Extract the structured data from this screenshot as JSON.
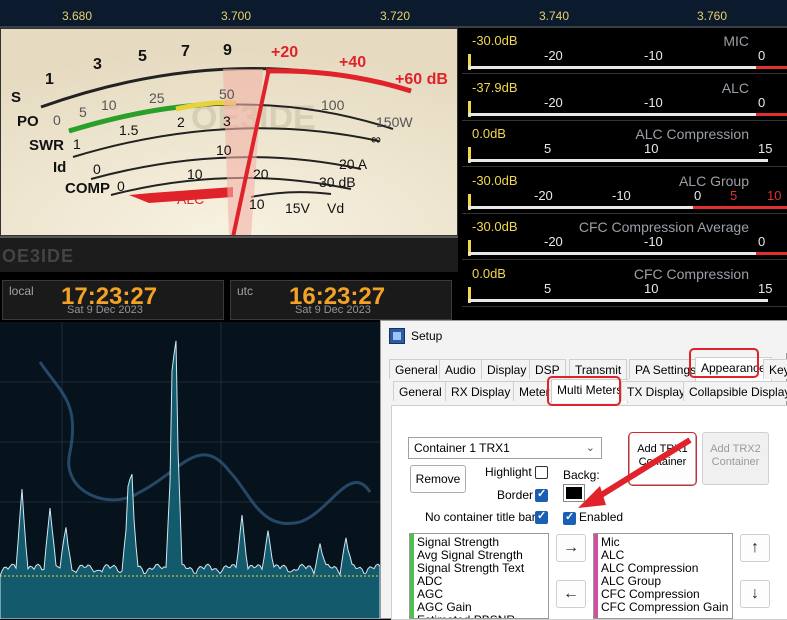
{
  "freq": {
    "labels": [
      "3.680",
      "3.700",
      "3.720",
      "3.740",
      "3.760"
    ]
  },
  "meter": {
    "s_label": "S",
    "po_label": "PO",
    "swr_label": "SWR",
    "id_label": "Id",
    "comp_label": "COMP",
    "s_scale": [
      "1",
      "3",
      "5",
      "7",
      "9",
      "+20",
      "+40",
      "+60 dB"
    ],
    "po_scale": [
      "0",
      "5",
      "10",
      "25",
      "50",
      "100",
      "150W"
    ],
    "swr_scale": [
      "1",
      "1.5",
      "2",
      "3",
      "∞"
    ],
    "id_scale": [
      "0",
      "10",
      "20 A"
    ],
    "comp_scale": [
      "0",
      "10",
      "20",
      "30 dB"
    ],
    "alc_label": "ALC",
    "vd_scale": [
      "10",
      "15V",
      "Vd"
    ],
    "watermark": "OE3IDE",
    "needle_pct": 0.52
  },
  "brand": "OE3IDE",
  "clocks": [
    {
      "label": "local",
      "time": "17:23:27",
      "date": "Sat 9 Dec 2023"
    },
    {
      "label": "utc",
      "time": "16:23:27",
      "date": "Sat 9 Dec 2023"
    }
  ],
  "rmeters": [
    {
      "value": "-30.0dB",
      "name": "MIC",
      "scale": [
        "-20",
        "-10",
        "0"
      ],
      "red_from": 0.96
    },
    {
      "value": "-37.9dB",
      "name": "ALC",
      "scale": [
        "-20",
        "-10",
        "0"
      ],
      "red_from": 0.96
    },
    {
      "value": "0.0dB",
      "name": "ALC Compression",
      "scale": [
        "5",
        "10",
        "15"
      ],
      "red_from": 1
    },
    {
      "value": "-30.0dB",
      "name": "ALC Group",
      "scale": [
        "-20",
        "-10",
        "0",
        "5",
        "10"
      ],
      "red_from": 0.75
    },
    {
      "value": "-30.0dB",
      "name": "CFC Compression Average",
      "scale": [
        "-20",
        "-10",
        "0"
      ],
      "red_from": 0.96
    },
    {
      "value": "0.0dB",
      "name": "CFC Compression",
      "scale": [
        "5",
        "10",
        "15"
      ],
      "red_from": 1
    }
  ],
  "setup": {
    "title": "Setup",
    "top_tabs": [
      "General",
      "Audio",
      "Display",
      "DSP",
      "Transmit",
      "PA Settings",
      "Appearance",
      "Keyb"
    ],
    "sub_tabs": [
      "General",
      "RX Display",
      "Meter",
      "Multi Meters",
      "TX Display",
      "Collapsible Display"
    ],
    "container_select": "Container 1 TRX1",
    "remove_btn": "Remove",
    "add_trx1_btn": "Add TRX1 Container",
    "add_trx2_btn": "Add TRX2 Container",
    "highlight_label": "Highlight",
    "border_label": "Border",
    "no_title_label": "No container title bar",
    "backg_label": "Backg:",
    "enabled_label": "Enabled",
    "available_list": [
      "Signal Strength",
      "Avg Signal Strength",
      "Signal Strength Text",
      "ADC",
      "AGC",
      "AGC Gain",
      "Estimated PBSNR"
    ],
    "selected_list": [
      "Mic",
      "ALC",
      "ALC Compression",
      "ALC Group",
      "CFC Compression",
      "CFC Compression Gain"
    ],
    "highlight_checked": false,
    "border_checked": true,
    "no_title_checked": true,
    "enabled_checked": true
  },
  "colors": {
    "accent_red": "#e0232a",
    "clock_orange": "#f2a325",
    "meter_yellow": "#f0d84a"
  }
}
